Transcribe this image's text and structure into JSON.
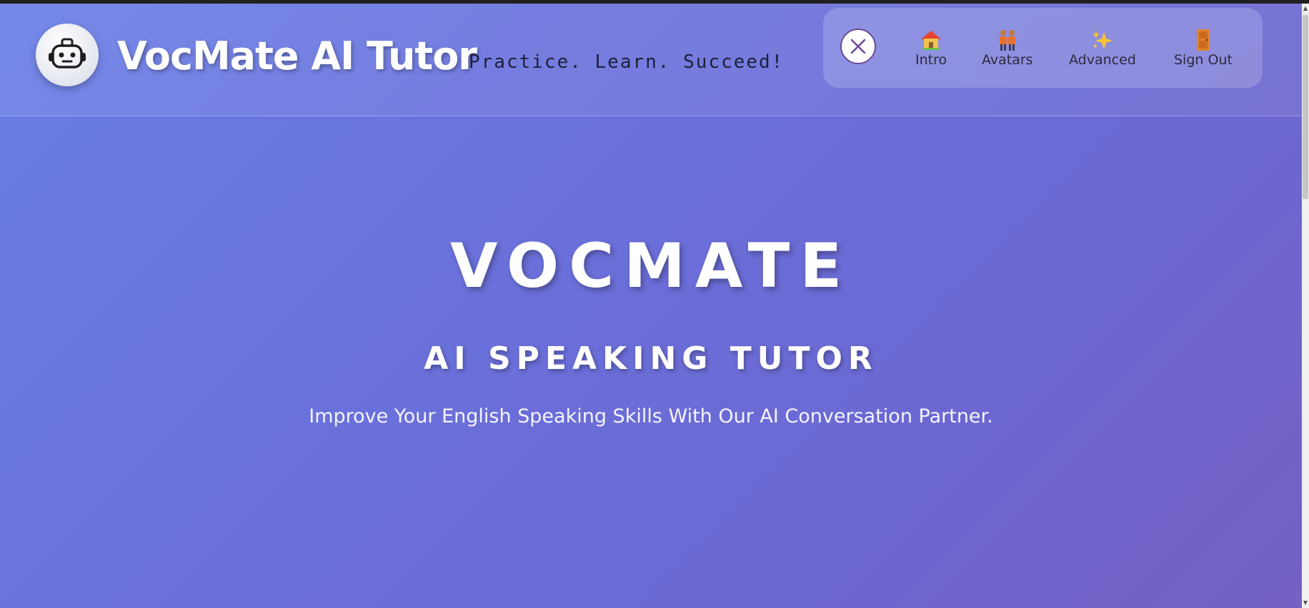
{
  "header": {
    "brand_title": "VocMate AI Tutor",
    "tagline": "Practice. Learn. Succeed!",
    "logo_icon": "robot-icon"
  },
  "nav": {
    "close_icon": "close-icon",
    "items": [
      {
        "label": "Intro",
        "icon": "house-icon"
      },
      {
        "label": "Avatars",
        "icon": "people-icon"
      },
      {
        "label": "Advanced",
        "icon": "sparkles-icon"
      },
      {
        "label": "Sign Out",
        "icon": "door-icon"
      }
    ]
  },
  "hero": {
    "title": "VOCMATE",
    "subtitle": "AI SPEAKING TUTOR",
    "description": "Improve Your English Speaking Skills With Our AI Conversation Partner."
  },
  "colors": {
    "background_start": "#6a7ee6",
    "background_end": "#7560c4",
    "text_light": "#ffffff",
    "nav_text": "#2b2b3c",
    "close_border": "#6a4a9a"
  }
}
